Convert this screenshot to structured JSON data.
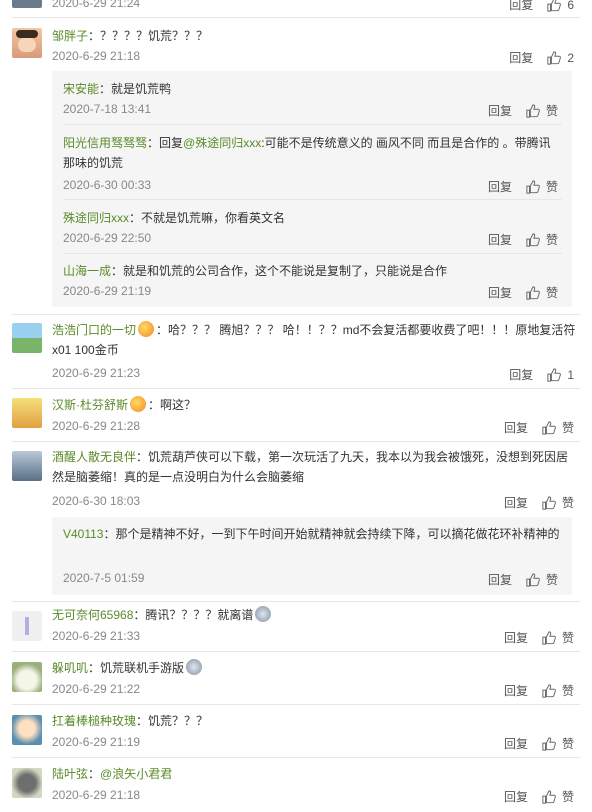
{
  "comments": [
    {
      "time": "2020-6-29 21:24",
      "reply": "回复",
      "likes": "6"
    },
    {
      "user": "邹胖子",
      "sep": "：",
      "text": "？？？？饥荒？？？",
      "time": "2020-6-29 21:18",
      "reply": "回复",
      "likes": "2",
      "replies": [
        {
          "user": "宋安能",
          "sep": "：",
          "text": "就是饥荒鸭",
          "time": "2020-7-18 13:41",
          "reply": "回复",
          "likes": "赞"
        },
        {
          "user": "阳光信用驽驽驽",
          "sep": "：",
          "text1": "回复",
          "mention": "@殊途同归xxx",
          "text2": ":可能不是传统意义的  画风不同 而且是合作的  。带腾讯那味的饥荒",
          "time": "2020-6-30 00:33",
          "reply": "回复",
          "likes": "赞"
        },
        {
          "user": "殊途同归xxx",
          "sep": "：",
          "text": "不就是饥荒嘛，你看英文名",
          "time": "2020-6-29 22:50",
          "reply": "回复",
          "likes": "赞"
        },
        {
          "user": "山海一成",
          "sep": "：",
          "text": "就是和饥荒的公司合作，这个不能说是复制了，只能说是合作",
          "time": "2020-6-29 21:19",
          "reply": "回复",
          "likes": "赞"
        }
      ]
    },
    {
      "user": "浩浩门口的一切",
      "sep": "：",
      "text": "哈？？？ 腾旭？？？ 哈！！？？md不会复活都要收费了吧！！！原地复活符x01 100金币",
      "time": "2020-6-29 21:23",
      "reply": "回复",
      "likes": "1"
    },
    {
      "user": "汉斯·杜芬舒斯",
      "sep": "：",
      "text": "啊这？",
      "time": "2020-6-29 21:28",
      "reply": "回复",
      "likes": "赞"
    },
    {
      "user": "酒醒人散无良伴",
      "sep": "：",
      "text": "饥荒葫芦侠可以下载，第一次玩活了九天，我本以为我会被饿死，没想到死因居然是脑萎缩！真的是一点没明白为什么会脑萎缩",
      "time": "2020-6-30 18:03",
      "reply": "回复",
      "likes": "赞",
      "replies": [
        {
          "user": "V40113",
          "sep": "：",
          "text": "那个是精神不好，一到下午时间开始就精神就会持续下降，可以摘花做花环补精神的",
          "time": "2020-7-5 01:59",
          "reply": "回复",
          "likes": "赞"
        }
      ]
    },
    {
      "user": "无可奈何65968",
      "sep": "：",
      "text": "腾讯？？？？就离谱",
      "time": "2020-6-29 21:33",
      "reply": "回复",
      "likes": "赞"
    },
    {
      "user": "躲叽叽",
      "sep": "：",
      "text": "饥荒联机手游版",
      "time": "2020-6-29 21:22",
      "reply": "回复",
      "likes": "赞"
    },
    {
      "user": "扛着棒槌种玫瑰",
      "sep": "：",
      "text": "饥荒？？？",
      "time": "2020-6-29 21:19",
      "reply": "回复",
      "likes": "赞"
    },
    {
      "user": "陆叶弦",
      "sep": "：",
      "text": "@浪矢小君君",
      "time": "2020-6-29 21:18",
      "reply": "回复",
      "likes": "赞"
    }
  ]
}
